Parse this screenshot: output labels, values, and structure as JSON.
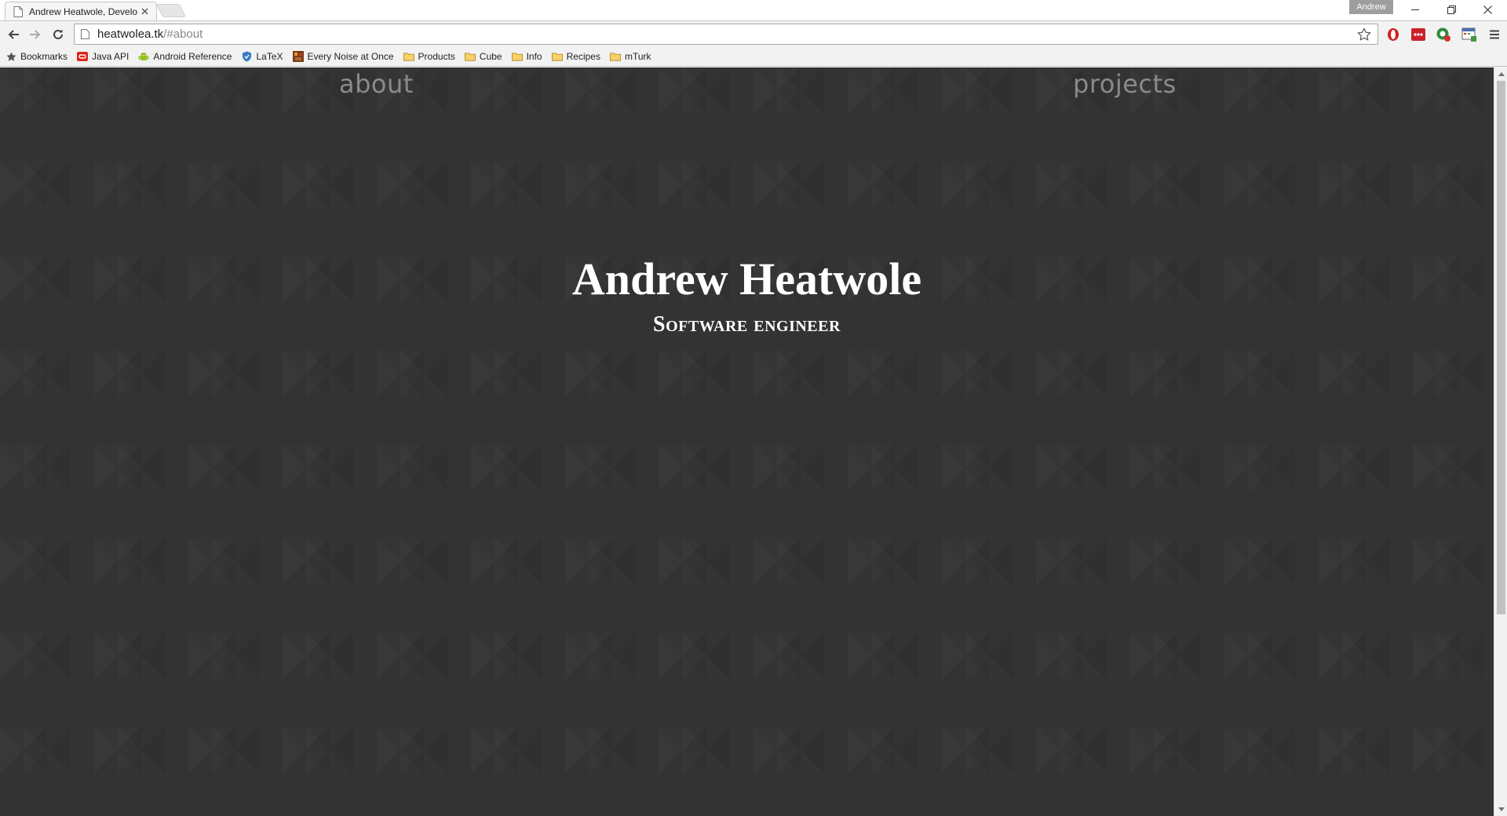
{
  "browser": {
    "tab": {
      "title": "Andrew Heatwole, Develo"
    },
    "profile_name": "Andrew",
    "address": {
      "host": "heatwolea.tk",
      "path": "/#about"
    },
    "bookmarks": [
      {
        "label": "Bookmarks",
        "icon": "star-icon"
      },
      {
        "label": "Java API",
        "icon": "oracle-icon"
      },
      {
        "label": "Android Reference",
        "icon": "android-icon"
      },
      {
        "label": "LaTeX",
        "icon": "shield-icon"
      },
      {
        "label": "Every Noise at Once",
        "icon": "noise-icon"
      },
      {
        "label": "Products",
        "icon": "folder-icon"
      },
      {
        "label": "Cube",
        "icon": "folder-icon"
      },
      {
        "label": "Info",
        "icon": "folder-icon"
      },
      {
        "label": "Recipes",
        "icon": "folder-icon"
      },
      {
        "label": "mTurk",
        "icon": "folder-icon"
      }
    ]
  },
  "site": {
    "nav": {
      "about": "about",
      "projects": "projects"
    },
    "hero": {
      "name": "Andrew Heatwole",
      "tagline": "Software engineer"
    }
  },
  "colors": {
    "page_background": "#333333",
    "nav_text": "#8a8a8a",
    "hero_text": "#ffffff"
  }
}
